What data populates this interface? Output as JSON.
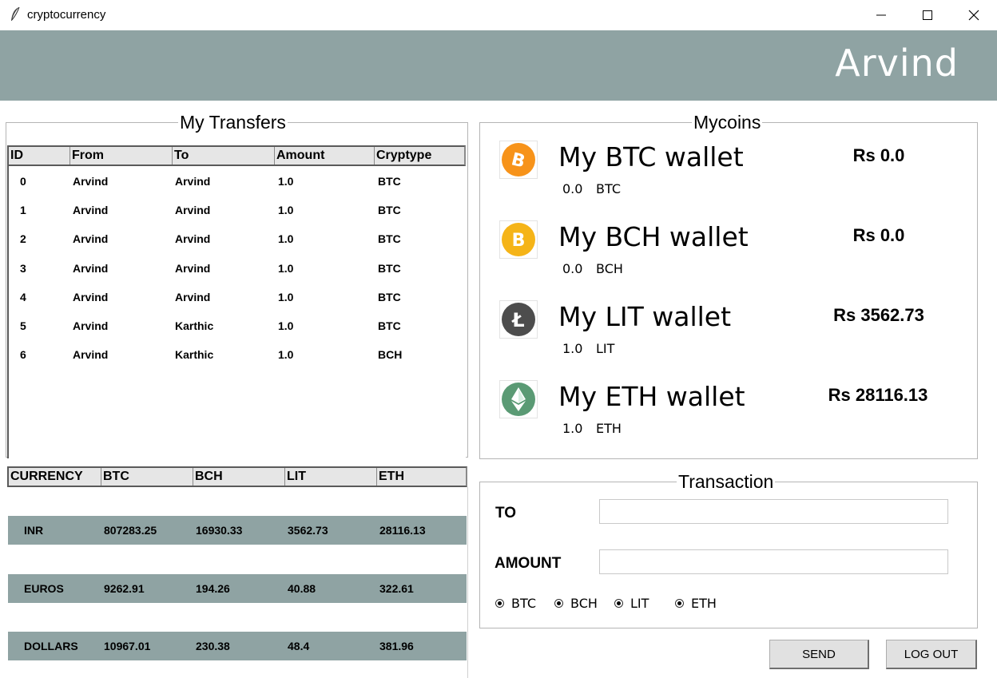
{
  "window": {
    "title": "cryptocurrency"
  },
  "header": {
    "username": "Arvind"
  },
  "transfers": {
    "title": "My Transfers",
    "columns": [
      "ID",
      "From",
      "To",
      "Amount",
      "Cryptype"
    ],
    "rows": [
      [
        "0",
        "Arvind",
        "Arvind",
        "1.0",
        "BTC"
      ],
      [
        "1",
        "Arvind",
        "Arvind",
        "1.0",
        "BTC"
      ],
      [
        "2",
        "Arvind",
        "Arvind",
        "1.0",
        "BTC"
      ],
      [
        "3",
        "Arvind",
        "Arvind",
        "1.0",
        "BTC"
      ],
      [
        "4",
        "Arvind",
        "Arvind",
        "1.0",
        "BTC"
      ],
      [
        "5",
        "Arvind",
        "Karthic",
        "1.0",
        "BTC"
      ],
      [
        "6",
        "Arvind",
        "Karthic",
        "1.0",
        "BCH"
      ]
    ]
  },
  "rates": {
    "columns": [
      "CURRENCY",
      "BTC",
      "BCH",
      "LIT",
      "ETH"
    ],
    "rows": [
      [
        "INR",
        "807283.25",
        "16930.33",
        "3562.73",
        "28116.13"
      ],
      [
        "EUROS",
        "9262.91",
        "194.26",
        "40.88",
        "322.61"
      ],
      [
        "DOLLARS",
        "10967.01",
        "230.38",
        "48.4",
        "381.96"
      ]
    ]
  },
  "mycoins": {
    "title": "Mycoins",
    "wallets": [
      {
        "name": "My BTC wallet",
        "amount": "0.0",
        "unit": "BTC",
        "value": "Rs 0.0",
        "icon": "bitcoin-icon",
        "color": "#f7931a"
      },
      {
        "name": "My BCH wallet",
        "amount": "0.0",
        "unit": "BCH",
        "value": "Rs 0.0",
        "icon": "bitcoin-cash-icon",
        "color": "#f5b418"
      },
      {
        "name": "My LIT wallet",
        "amount": "1.0",
        "unit": "LIT",
        "value": "Rs 3562.73",
        "icon": "litecoin-icon",
        "color": "#4d4d4d"
      },
      {
        "name": "My ETH wallet",
        "amount": "1.0",
        "unit": "ETH",
        "value": "Rs 28116.13",
        "icon": "ethereum-icon",
        "color": "#5a9a74"
      }
    ]
  },
  "transaction": {
    "title": "Transaction",
    "to_label": "TO",
    "to_value": "",
    "amount_label": "AMOUNT",
    "amount_value": "",
    "options": [
      "BTC",
      "BCH",
      "LIT",
      "ETH"
    ]
  },
  "buttons": {
    "send": "SEND",
    "logout": "LOG OUT"
  },
  "colors": {
    "banner": "#8fa3a3",
    "row_highlight": "#8fa3a3"
  }
}
